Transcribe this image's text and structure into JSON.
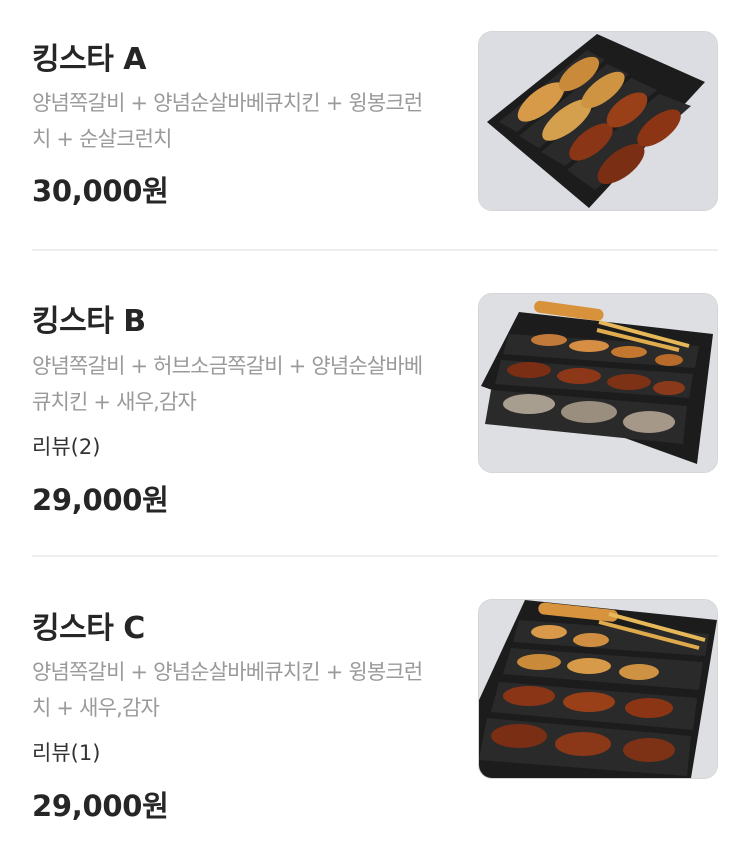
{
  "menu": {
    "items": [
      {
        "name": "킹스타 A",
        "description": "양념쪽갈비 + 양념순살바베큐치킨 + 윙봉크런치 + 순살크런치",
        "review": "",
        "price": "30,000원",
        "image": "chicken-box-photo"
      },
      {
        "name": "킹스타 B",
        "description": "양념쪽갈비 + 허브소금쪽갈비 + 양념순살바베큐치킨 + 새우,감자",
        "review": "리뷰(2)",
        "price": "29,000원",
        "image": "chicken-box-photo"
      },
      {
        "name": "킹스타 C",
        "description": "양념쪽갈비 + 양념순살바베큐치킨 + 윙봉크런치 + 새우,감자",
        "review": "리뷰(1)",
        "price": "29,000원",
        "image": "chicken-box-photo"
      }
    ]
  },
  "colors": {
    "background": "#ffffff",
    "title": "#262626",
    "description": "#9a9a9a",
    "divider": "#eeeeee",
    "tray": "#1c1c1c",
    "fried": "#c98a3a",
    "sauced": "#7a2e14"
  }
}
